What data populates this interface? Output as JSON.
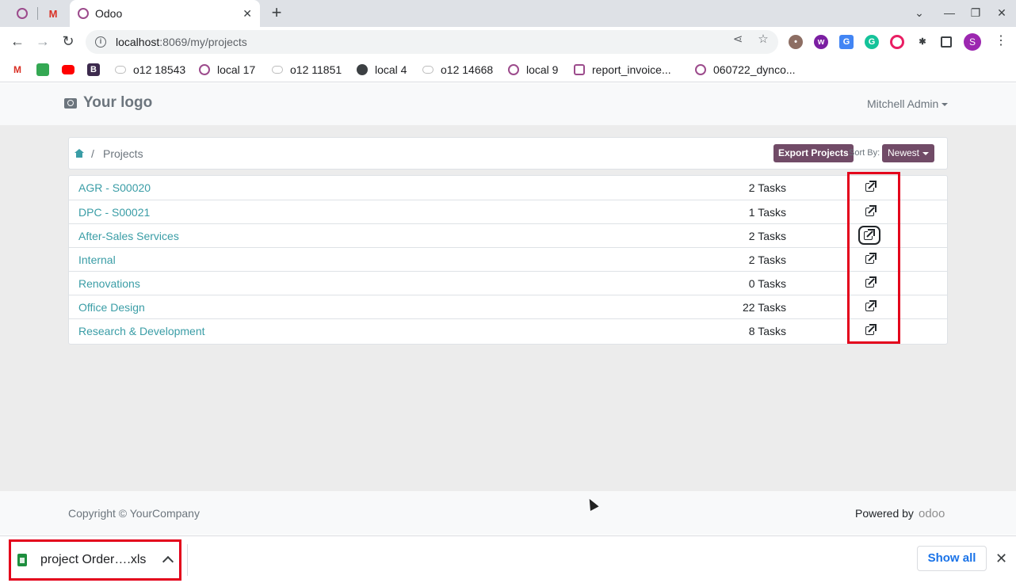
{
  "browser": {
    "active_tab_title": "Odoo",
    "tab_close": "✕",
    "new_tab": "+",
    "url_host": "localhost",
    "url_path": ":8069/my/projects",
    "profile_initial": "S",
    "window_controls": [
      "⌄",
      "—",
      "❐",
      "✕"
    ],
    "bookmarks": [
      {
        "label": "",
        "icon": "gmail-icon"
      },
      {
        "label": "",
        "icon": "thumbs-up-icon"
      },
      {
        "label": "",
        "icon": "youtube-icon"
      },
      {
        "label": "",
        "icon": "bootstrap-icon"
      },
      {
        "label": "o12 18543",
        "icon": "cloud-icon"
      },
      {
        "label": "local 17",
        "icon": "odoo-ring-icon"
      },
      {
        "label": "o12 11851",
        "icon": "cloud-icon"
      },
      {
        "label": "local 4",
        "icon": "globe-icon"
      },
      {
        "label": "o12 14668",
        "icon": "cloud-icon"
      },
      {
        "label": "local 9",
        "icon": "odoo-ring-icon"
      },
      {
        "label": "report_invoice...",
        "icon": "odoo-ring-icon"
      },
      {
        "label": "060722_dynco...",
        "icon": "odoo-ring-icon"
      }
    ]
  },
  "site": {
    "logo_text": "Your logo",
    "user_name": "Mitchell Admin"
  },
  "breadcrumb": {
    "separator": "/",
    "current": "Projects"
  },
  "actions": {
    "export_label": "Export Projects",
    "sort_label": "Sort By:",
    "sort_value": "Newest"
  },
  "projects": [
    {
      "name": "AGR - S00020",
      "tasks": "2 Tasks"
    },
    {
      "name": "DPC - S00021",
      "tasks": "1 Tasks"
    },
    {
      "name": "After-Sales Services",
      "tasks": "2 Tasks"
    },
    {
      "name": "Internal",
      "tasks": "2 Tasks"
    },
    {
      "name": "Renovations",
      "tasks": "0 Tasks"
    },
    {
      "name": "Office Design",
      "tasks": "22 Tasks"
    },
    {
      "name": "Research & Development",
      "tasks": "8 Tasks"
    }
  ],
  "footer": {
    "copyright": "Copyright © YourCompany",
    "powered_by": "Powered by",
    "odoo_logo": "odoo"
  },
  "download_bar": {
    "file_name": "project Order….xls",
    "show_all": "Show all",
    "close": "✕"
  },
  "colors": {
    "link": "#3a9da6",
    "brand": "#714b67",
    "highlight": "#e3001b"
  }
}
